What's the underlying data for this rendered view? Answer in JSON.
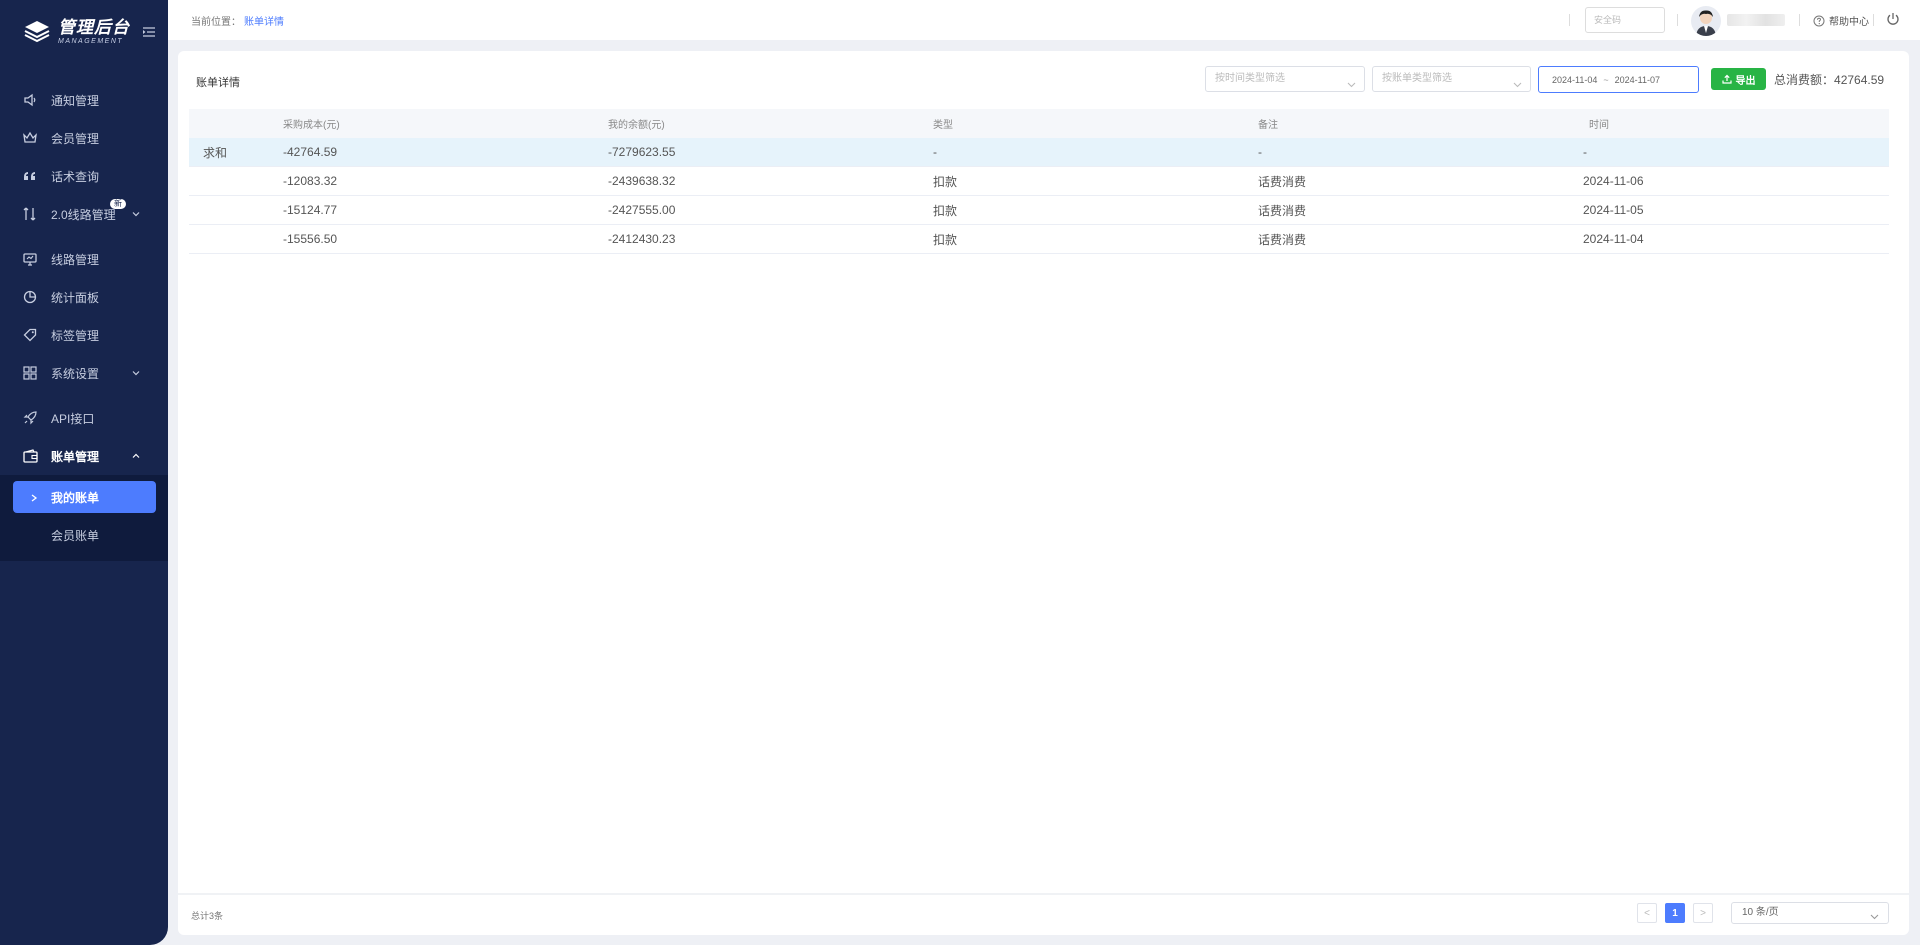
{
  "app": {
    "title": "管理后台",
    "subtitle": "MANAGEMENT"
  },
  "sidebar": {
    "items": [
      {
        "label": "通知管理",
        "icon": "speaker-icon"
      },
      {
        "label": "会员管理",
        "icon": "crown-icon"
      },
      {
        "label": "话术查询",
        "icon": "quote-icon"
      },
      {
        "label": "2.0线路管理",
        "icon": "route-icon",
        "badge": "新",
        "has_arrow": true
      },
      {
        "label": "线路管理",
        "icon": "monitor-icon"
      },
      {
        "label": "统计面板",
        "icon": "pie-chart-icon"
      },
      {
        "label": "标签管理",
        "icon": "tag-icon"
      },
      {
        "label": "系统设置",
        "icon": "grid-icon",
        "has_arrow": true
      },
      {
        "label": "API接口",
        "icon": "rocket-icon"
      },
      {
        "label": "账单管理",
        "icon": "wallet-icon",
        "open": true
      }
    ],
    "submenu": [
      {
        "label": "我的账单",
        "active": true
      },
      {
        "label": "会员账单",
        "active": false
      }
    ]
  },
  "header": {
    "crumb_label": "当前位置：",
    "crumb_current": "账单详情",
    "security_placeholder": "安全码",
    "help_label": "帮助中心"
  },
  "card": {
    "title": "账单详情",
    "time_filter_placeholder": "按时间类型筛选",
    "bill_filter_placeholder": "按账单类型筛选",
    "date_start": "2024-11-04",
    "date_sep": "~",
    "date_end": "2024-11-07",
    "export_label": "导出",
    "total_label": "总消费额：",
    "total_value": "42764.59"
  },
  "table": {
    "columns": [
      "",
      "采购成本(元)",
      "我的余额(元)",
      "类型",
      "备注",
      "时间"
    ],
    "sum_row": [
      "求和",
      "-42764.59",
      "-7279623.55",
      "-",
      "-",
      "-"
    ],
    "rows": [
      [
        "",
        "-12083.32",
        "-2439638.32",
        "扣款",
        "话费消费",
        "2024-11-06"
      ],
      [
        "",
        "-15124.77",
        "-2427555.00",
        "扣款",
        "话费消费",
        "2024-11-05"
      ],
      [
        "",
        "-15556.50",
        "-2412430.23",
        "扣款",
        "话费消费",
        "2024-11-04"
      ]
    ]
  },
  "footer": {
    "total_text": "总计3条",
    "prev": "<",
    "current_page": "1",
    "next": ">",
    "page_size": "10 条/页"
  },
  "colors": {
    "sidebar_bg": "#17254d",
    "accent": "#4d7cfe",
    "export_green": "#28b445",
    "sum_row_bg": "#e6f3fb"
  }
}
